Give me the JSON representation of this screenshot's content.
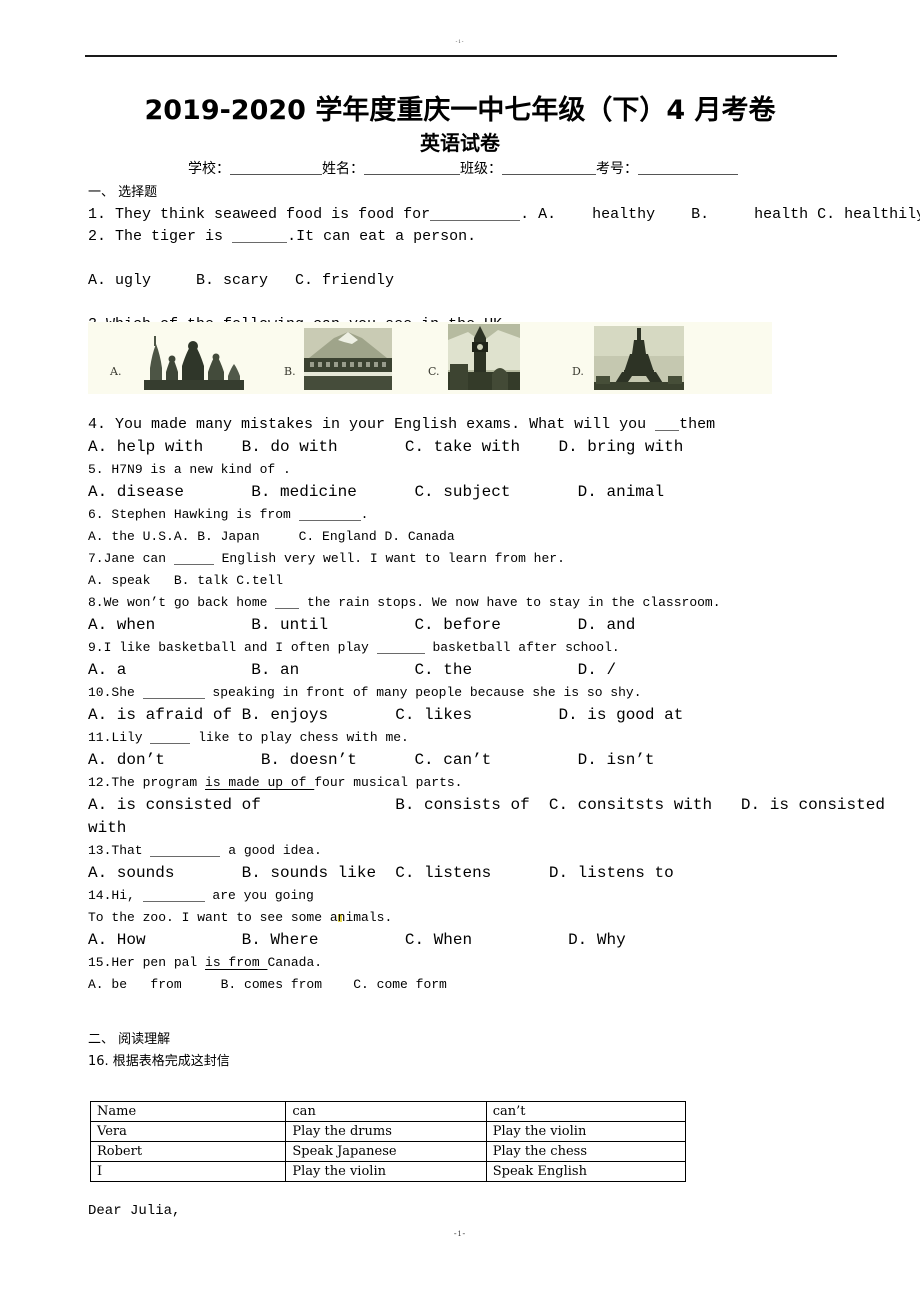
{
  "page": {
    "header_mark": "-1-",
    "footer_mark": "-1-",
    "title_main": "2019-2020 学年度重庆一中七年级（下）4 月考卷",
    "title_sub": "英语试卷"
  },
  "id_fields": [
    {
      "label": "学校："
    },
    {
      "label": "姓名："
    },
    {
      "label": "班级："
    },
    {
      "label": "考号："
    }
  ],
  "sections": {
    "one_heading": "一、 选择题",
    "two_heading": "二、 阅读理解",
    "two_prompt": "16. 根据表格完成这封信"
  },
  "questions": [
    {
      "num": "1.",
      "stem_a": "They think seaweed food is food for",
      "stem_b": ". A.    healthy    B.     health C. healthily"
    },
    {
      "num": "2.",
      "stem_a": "The tiger is ",
      "stem_b": ".It can eat a person.",
      "options": "A. ugly     B. scary   C. friendly"
    },
    {
      "num": "3.",
      "stem_a": "Which of the following can you see in the UK",
      "pictures": [
        {
          "letter": "A.",
          "alt": "saint-basils-cathedral"
        },
        {
          "letter": "B.",
          "alt": "mount-fuji"
        },
        {
          "letter": "C.",
          "alt": "big-ben"
        },
        {
          "letter": "D.",
          "alt": "eiffel-tower"
        }
      ]
    },
    {
      "num": "4.",
      "stem_a": " You made many mistakes in your English exams. What will you ",
      "stem_b": "them",
      "options": "A. help with    B. do with       C. take with    D. bring with"
    },
    {
      "num": "5.",
      "stem_a": " H7N9 is a new kind of .",
      "options": "A. disease       B. medicine      C. subject       D. animal"
    },
    {
      "num": "6.",
      "stem_a": " Stephen Hawking is from ",
      "stem_b": ".",
      "options": "A. the U.S.A. B. Japan     C. England D. Canada"
    },
    {
      "num": "7.",
      "stem_a": "Jane can ",
      "stem_b": " English very well. I want to learn from her.",
      "options": "A. speak   B. talk C.tell"
    },
    {
      "num": "8.",
      "stem_a": "We won’t go back home ",
      "stem_b": " the rain stops. We now have to stay in the classroom.",
      "options": "A. when          B. until         C. before        D. and"
    },
    {
      "num": "9.",
      "stem_a": "I like basketball and I often play ",
      "stem_b": " basketball after school.",
      "options": "A. a             B. an            C. the           D. /"
    },
    {
      "num": "10.",
      "stem_a": "She ",
      "stem_b": " speaking in front of many people because she is so shy.",
      "options": "A. is afraid of B. enjoys       C. likes         D. is good at"
    },
    {
      "num": "11.",
      "stem_a": "Lily ",
      "stem_b": " like to play chess with me.",
      "options": "A. don’t          B. doesn’t      C. can’t         D. isn’t"
    },
    {
      "num": "12.",
      "stem_a": "The program ",
      "underlined": "is made up of ",
      "stem_b": "four musical parts.",
      "options_line1": "A. is consisted of              B. consists of  C. consitsts with   D. is consisted",
      "options_line2": "with"
    },
    {
      "num": "13.",
      "stem_a": "That ",
      "stem_b": " a good idea.",
      "options": "A. sounds       B. sounds like  C. listens      D. listens to"
    },
    {
      "num": "14.",
      "stem_a": "Hi, ",
      "stem_b": " are you going",
      "stem_c": "To the zoo. I want to see some a",
      "stem_d": "nimals.",
      "options": "A. How          B. Where         C. When          D. Why"
    },
    {
      "num": "15.",
      "stem_a": "Her pen pal ",
      "underlined": "is from ",
      "stem_b": "Canada.",
      "options": "A. be   from     B. comes from    C. come form"
    }
  ],
  "table": {
    "headers": [
      "Name",
      "can",
      "can’t"
    ],
    "rows": [
      [
        "Vera",
        "Play the drums",
        "Play the violin"
      ],
      [
        "Robert",
        "Speak Japanese",
        "Play the chess"
      ],
      [
        "I",
        "Play the violin",
        "Speak English"
      ]
    ]
  },
  "letter": {
    "salutation": "Dear Julia,"
  }
}
